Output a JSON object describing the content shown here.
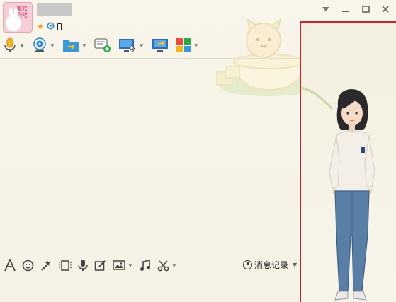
{
  "header": {
    "avatar_text": "毒欢 问候",
    "status_icons": [
      "star-icon",
      "qq-icon",
      "phone-icon"
    ]
  },
  "window_controls": [
    "dropdown-arrow-icon",
    "minimize-icon",
    "maximize-icon",
    "close-icon"
  ],
  "toolbar": {
    "items": [
      "voice-call",
      "video-call",
      "send-file",
      "create-discussion",
      "remote-desktop",
      "share-screen",
      "app-grid"
    ]
  },
  "bottom_toolbar": {
    "items": [
      "font",
      "emoji",
      "nudge",
      "gif",
      "voice-message",
      "screenshot-edit",
      "image",
      "music",
      "cut"
    ],
    "history_label": "消息记录"
  },
  "colors": {
    "side_panel_border": "#c0262b",
    "background": "#f6f2e6",
    "accent_blue": "#2f8bd6"
  }
}
